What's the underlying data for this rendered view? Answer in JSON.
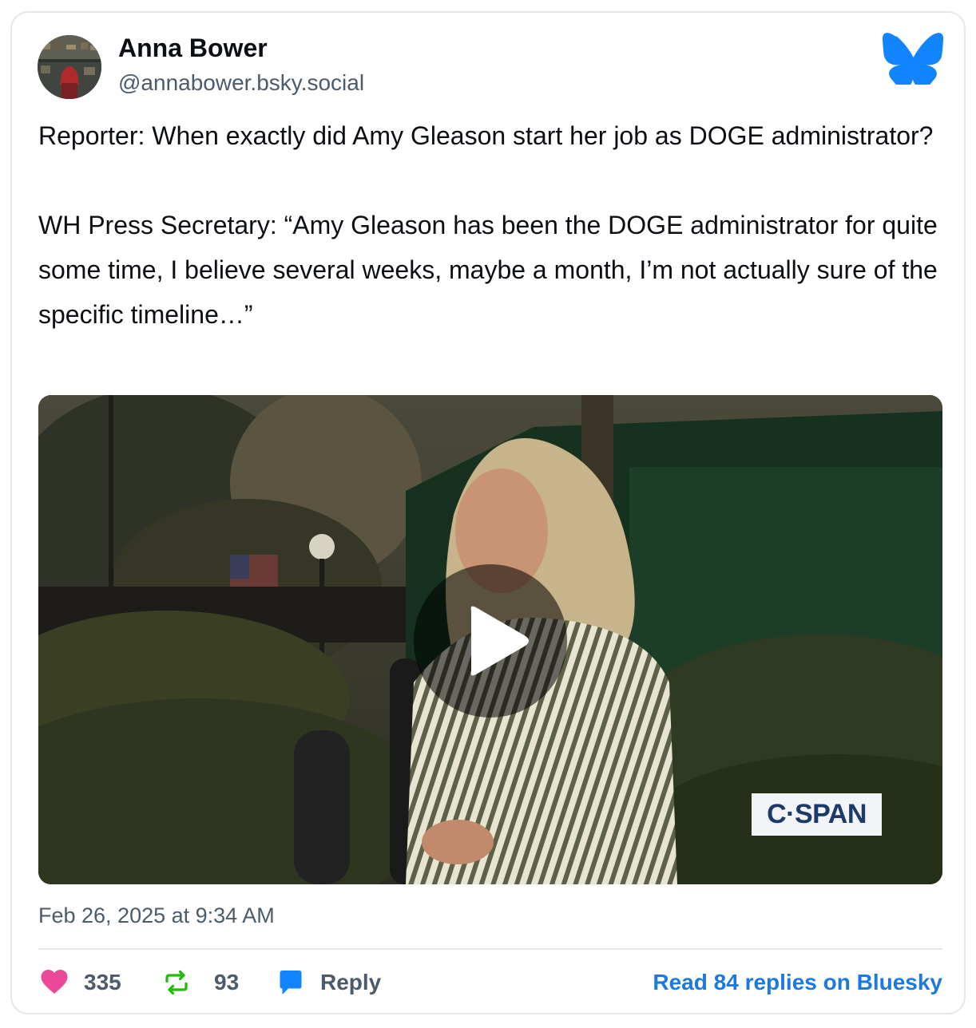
{
  "author": {
    "name": "Anna Bower",
    "handle": "@annabower.bsky.social"
  },
  "post": {
    "paragraphs": [
      "Reporter: When exactly did Amy Gleason start her job as DOGE administrator?",
      "WH Press Secretary: “Amy Gleason has been the DOGE administrator for quite some time, I believe several weeks, maybe a month, I’m not actually sure of the specific timeline…”"
    ],
    "video": {
      "watermark": "C·SPAN"
    },
    "timestamp": "Feb 26, 2025 at 9:34 AM"
  },
  "actions": {
    "likes": "335",
    "reposts": "93",
    "reply_label": "Reply",
    "read_replies": "Read 84 replies on Bluesky"
  },
  "colors": {
    "brand": "#1185fe",
    "like": "#ec4899",
    "repost": "#20bc07",
    "link": "#1a7ae0"
  },
  "icons": [
    "bluesky-butterfly-icon",
    "heart-icon",
    "repost-icon",
    "reply-bubble-icon",
    "play-icon"
  ]
}
